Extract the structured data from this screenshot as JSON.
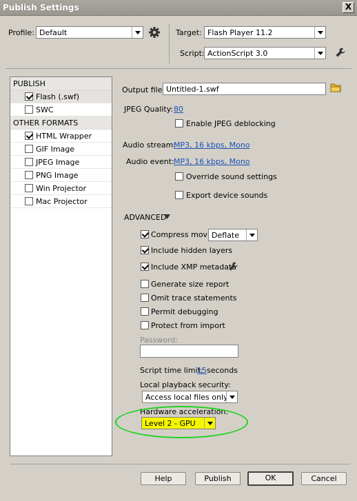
{
  "window": {
    "title": "Publish Settings",
    "close_label": "X"
  },
  "profile": {
    "label": "Profile:",
    "value": "Default"
  },
  "target": {
    "label": "Target:",
    "value": "Flash Player 11.2"
  },
  "script": {
    "label": "Script:",
    "value": "ActionScript 3.0"
  },
  "left_panel": {
    "publish_header": "PUBLISH",
    "publish_items": [
      {
        "label": "Flash (.swf)",
        "checked": true
      },
      {
        "label": "SWC",
        "checked": false
      }
    ],
    "other_header": "OTHER FORMATS",
    "other_items": [
      {
        "label": "HTML Wrapper",
        "checked": true
      },
      {
        "label": "GIF Image",
        "checked": false
      },
      {
        "label": "JPEG Image",
        "checked": false
      },
      {
        "label": "PNG Image",
        "checked": false
      },
      {
        "label": "Win Projector",
        "checked": false
      },
      {
        "label": "Mac Projector",
        "checked": false
      }
    ]
  },
  "output_file": {
    "label": "Output file:",
    "value": "Untitled-1.swf"
  },
  "jpeg": {
    "quality_label": "JPEG Quality:",
    "quality_value": "80",
    "deblocking_label": "Enable JPEG deblocking",
    "deblocking_checked": false
  },
  "audio": {
    "stream_label": "Audio stream:",
    "stream_value": "MP3, 16 kbps, Mono",
    "event_label": "Audio event:",
    "event_value": "MP3, 16 kbps, Mono",
    "override_label": "Override sound settings",
    "override_checked": false,
    "export_label": "Export device sounds",
    "export_checked": false
  },
  "advanced": {
    "header": "ADVANCED",
    "compress_label": "Compress movie",
    "compress_checked": true,
    "compress_value": "Deflate",
    "hidden_layers_label": "Include hidden layers",
    "hidden_layers_checked": true,
    "xmp_label": "Include XMP metadata",
    "xmp_checked": true,
    "size_report_label": "Generate size report",
    "size_report_checked": false,
    "omit_trace_label": "Omit trace statements",
    "omit_trace_checked": false,
    "permit_debug_label": "Permit debugging",
    "permit_debug_checked": false,
    "protect_label": "Protect from import",
    "protect_checked": false,
    "password_label": "Password:",
    "password_value": "",
    "script_time_label": "Script time limit:",
    "script_time_value": "15",
    "script_time_unit": "seconds",
    "local_security_label": "Local playback security:",
    "local_security_value": "Access local files only",
    "hw_accel_label": "Hardware acceleration:",
    "hw_accel_value": "Level 2 - GPU"
  },
  "buttons": {
    "help": "Help",
    "publish": "Publish",
    "ok": "OK",
    "cancel": "Cancel"
  },
  "colors": {
    "link": "#1a52b5",
    "highlight": "#f5f500",
    "annotation": "#1fd21f"
  },
  "icons": {
    "profile_settings": "gear-icon",
    "script_settings": "wrench-icon",
    "output_browse": "folder-icon",
    "xmp_settings": "wrench-icon"
  }
}
